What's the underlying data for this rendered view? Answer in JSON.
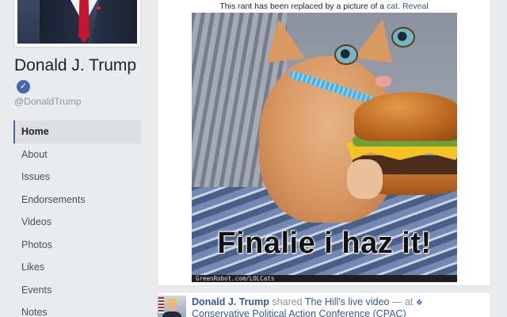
{
  "profile": {
    "name": "Donald J. Trump",
    "verified_mark": "✓",
    "handle": "@DonaldTrump"
  },
  "nav": {
    "items": [
      {
        "label": "Home",
        "active": true
      },
      {
        "label": "About"
      },
      {
        "label": "Issues"
      },
      {
        "label": "Endorsements"
      },
      {
        "label": "Videos"
      },
      {
        "label": "Photos"
      },
      {
        "label": "Likes"
      },
      {
        "label": "Events"
      },
      {
        "label": "Notes"
      }
    ]
  },
  "post": {
    "notice_prefix": "This rant has been replaced by a picture of a ",
    "notice_link": "cat",
    "notice_period": ".",
    "reveal_label": "Reveal",
    "image": {
      "caption": "Finalie i haz it!",
      "watermark": "GreenRobot.com/LOLCats"
    }
  },
  "post2": {
    "author": "Donald J. Trump",
    "action": " shared ",
    "shared_source": "The Hill's",
    "shared_link": "live video",
    "at_text": " — at ",
    "location": "Conservative Political Action Conference (CPAC)"
  },
  "colors": {
    "link": "#365899",
    "accent": "#4267b2",
    "background": "#e9ebee"
  }
}
